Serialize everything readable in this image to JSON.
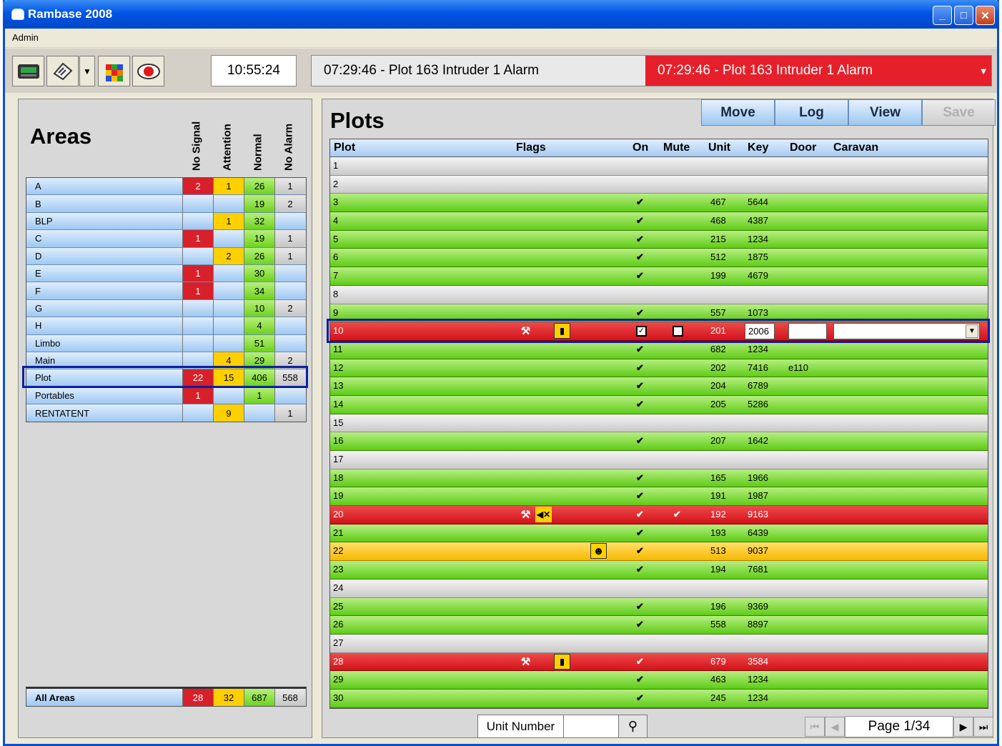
{
  "window": {
    "title": "Rambase 2008"
  },
  "menu": {
    "admin": "Admin"
  },
  "toolbar": {
    "icons": [
      "device-icon",
      "flash-icon",
      "dropdown-arrow-icon",
      "cube-icon",
      "alarm-record-icon"
    ],
    "clock": "10:55:24",
    "alarm_latest": "07:29:46 - Plot 163 Intruder 1 Alarm",
    "alarm_active": "07:29:46 - Plot 163 Intruder 1 Alarm"
  },
  "areas": {
    "title": "Areas",
    "headers": [
      "No Signal",
      "Attention",
      "Normal",
      "No Alarm"
    ],
    "rows": [
      {
        "name": "A",
        "no_signal": "2",
        "attention": "1",
        "normal": "26",
        "no_alarm": "1"
      },
      {
        "name": "B",
        "no_signal": "",
        "attention": "",
        "normal": "19",
        "no_alarm": "2"
      },
      {
        "name": "BLP",
        "no_signal": "",
        "attention": "1",
        "normal": "32",
        "no_alarm": ""
      },
      {
        "name": "C",
        "no_signal": "1",
        "attention": "",
        "normal": "19",
        "no_alarm": "1"
      },
      {
        "name": "D",
        "no_signal": "",
        "attention": "2",
        "normal": "26",
        "no_alarm": "1"
      },
      {
        "name": "E",
        "no_signal": "1",
        "attention": "",
        "normal": "30",
        "no_alarm": ""
      },
      {
        "name": "F",
        "no_signal": "1",
        "attention": "",
        "normal": "34",
        "no_alarm": ""
      },
      {
        "name": "G",
        "no_signal": "",
        "attention": "",
        "normal": "10",
        "no_alarm": "2"
      },
      {
        "name": "H",
        "no_signal": "",
        "attention": "",
        "normal": "4",
        "no_alarm": ""
      },
      {
        "name": "Limbo",
        "no_signal": "",
        "attention": "",
        "normal": "51",
        "no_alarm": ""
      },
      {
        "name": "Main",
        "no_signal": "",
        "attention": "4",
        "normal": "29",
        "no_alarm": "2"
      },
      {
        "name": "Plot",
        "no_signal": "22",
        "attention": "15",
        "normal": "406",
        "no_alarm": "558"
      },
      {
        "name": "Portables",
        "no_signal": "1",
        "attention": "",
        "normal": "1",
        "no_alarm": ""
      },
      {
        "name": "RENTATENT",
        "no_signal": "",
        "attention": "9",
        "normal": "",
        "no_alarm": "1"
      }
    ],
    "total": {
      "name": "All Areas",
      "no_signal": "28",
      "attention": "32",
      "normal": "687",
      "no_alarm": "568"
    }
  },
  "plots": {
    "title": "Plots",
    "buttons": {
      "move": "Move",
      "log": "Log",
      "view": "View",
      "save": "Save"
    },
    "headers": {
      "plot": "Plot",
      "flags": "Flags",
      "on": "On",
      "mute": "Mute",
      "unit": "Unit",
      "key": "Key",
      "door": "Door",
      "caravan": "Caravan"
    },
    "rows": [
      {
        "plot": "1",
        "status": "gray",
        "on": "",
        "mute": "",
        "unit": "",
        "key": "",
        "door": ""
      },
      {
        "plot": "2",
        "status": "gray",
        "on": "",
        "mute": "",
        "unit": "",
        "key": "",
        "door": ""
      },
      {
        "plot": "3",
        "status": "g",
        "on": "✔",
        "mute": "",
        "unit": "467",
        "key": "5644",
        "door": ""
      },
      {
        "plot": "4",
        "status": "g",
        "on": "✔",
        "mute": "",
        "unit": "468",
        "key": "4387",
        "door": ""
      },
      {
        "plot": "5",
        "status": "g",
        "on": "✔",
        "mute": "",
        "unit": "215",
        "key": "1234",
        "door": ""
      },
      {
        "plot": "6",
        "status": "g",
        "on": "✔",
        "mute": "",
        "unit": "512",
        "key": "1875",
        "door": ""
      },
      {
        "plot": "7",
        "status": "g",
        "on": "✔",
        "mute": "",
        "unit": "199",
        "key": "4679",
        "door": ""
      },
      {
        "plot": "8",
        "status": "gray",
        "on": "",
        "mute": "",
        "unit": "",
        "key": "",
        "door": ""
      },
      {
        "plot": "9",
        "status": "g",
        "on": "✔",
        "mute": "",
        "unit": "557",
        "key": "1073",
        "door": ""
      },
      {
        "plot": "10",
        "status": "red",
        "editing": true,
        "flags": [
          "tools-icon",
          "battery-icon"
        ],
        "on": "",
        "mute": "",
        "unit": "201",
        "key": "2006",
        "door": ""
      },
      {
        "plot": "11",
        "status": "g",
        "on": "✔",
        "mute": "",
        "unit": "682",
        "key": "1234",
        "door": ""
      },
      {
        "plot": "12",
        "status": "g",
        "on": "✔",
        "mute": "",
        "unit": "202",
        "key": "7416",
        "door": "e110"
      },
      {
        "plot": "13",
        "status": "g",
        "on": "✔",
        "mute": "",
        "unit": "204",
        "key": "6789",
        "door": ""
      },
      {
        "plot": "14",
        "status": "g",
        "on": "✔",
        "mute": "",
        "unit": "205",
        "key": "5286",
        "door": ""
      },
      {
        "plot": "15",
        "status": "gray",
        "on": "",
        "mute": "",
        "unit": "",
        "key": "",
        "door": ""
      },
      {
        "plot": "16",
        "status": "g",
        "on": "✔",
        "mute": "",
        "unit": "207",
        "key": "1642",
        "door": ""
      },
      {
        "plot": "17",
        "status": "gray",
        "on": "",
        "mute": "",
        "unit": "",
        "key": "",
        "door": ""
      },
      {
        "plot": "18",
        "status": "g",
        "on": "✔",
        "mute": "",
        "unit": "165",
        "key": "1966",
        "door": ""
      },
      {
        "plot": "19",
        "status": "g",
        "on": "✔",
        "mute": "",
        "unit": "191",
        "key": "1987",
        "door": ""
      },
      {
        "plot": "20",
        "status": "red",
        "flags": [
          "tools-icon",
          "mute-icon"
        ],
        "on": "✔",
        "mute": "✔",
        "unit": "192",
        "key": "9163",
        "door": ""
      },
      {
        "plot": "21",
        "status": "g",
        "on": "✔",
        "mute": "",
        "unit": "193",
        "key": "6439",
        "door": ""
      },
      {
        "plot": "22",
        "status": "yel",
        "flags": [
          "mask-icon"
        ],
        "on": "✔",
        "mute": "",
        "unit": "513",
        "key": "9037",
        "door": ""
      },
      {
        "plot": "23",
        "status": "g",
        "on": "✔",
        "mute": "",
        "unit": "194",
        "key": "7681",
        "door": ""
      },
      {
        "plot": "24",
        "status": "gray",
        "on": "",
        "mute": "",
        "unit": "",
        "key": "",
        "door": ""
      },
      {
        "plot": "25",
        "status": "g",
        "on": "✔",
        "mute": "",
        "unit": "196",
        "key": "9369",
        "door": ""
      },
      {
        "plot": "26",
        "status": "g",
        "on": "✔",
        "mute": "",
        "unit": "558",
        "key": "8897",
        "door": ""
      },
      {
        "plot": "27",
        "status": "gray",
        "on": "",
        "mute": "",
        "unit": "",
        "key": "",
        "door": ""
      },
      {
        "plot": "28",
        "status": "red",
        "flags": [
          "tools-icon",
          "battery-icon"
        ],
        "on": "✔",
        "mute": "",
        "unit": "679",
        "key": "3584",
        "door": ""
      },
      {
        "plot": "29",
        "status": "g",
        "on": "✔",
        "mute": "",
        "unit": "463",
        "key": "1234",
        "door": ""
      },
      {
        "plot": "30",
        "status": "g",
        "on": "✔",
        "mute": "",
        "unit": "245",
        "key": "1234",
        "door": ""
      }
    ],
    "search": {
      "label": "Unit Number",
      "value": ""
    },
    "pager": {
      "label": "Page 1/34"
    }
  },
  "colors": {
    "no_signal": "#D8202A",
    "attention": "#FFD000",
    "normal": "#6DD21F",
    "no_alarm": "#C6C6C6",
    "selection": "#0B1FA0"
  }
}
